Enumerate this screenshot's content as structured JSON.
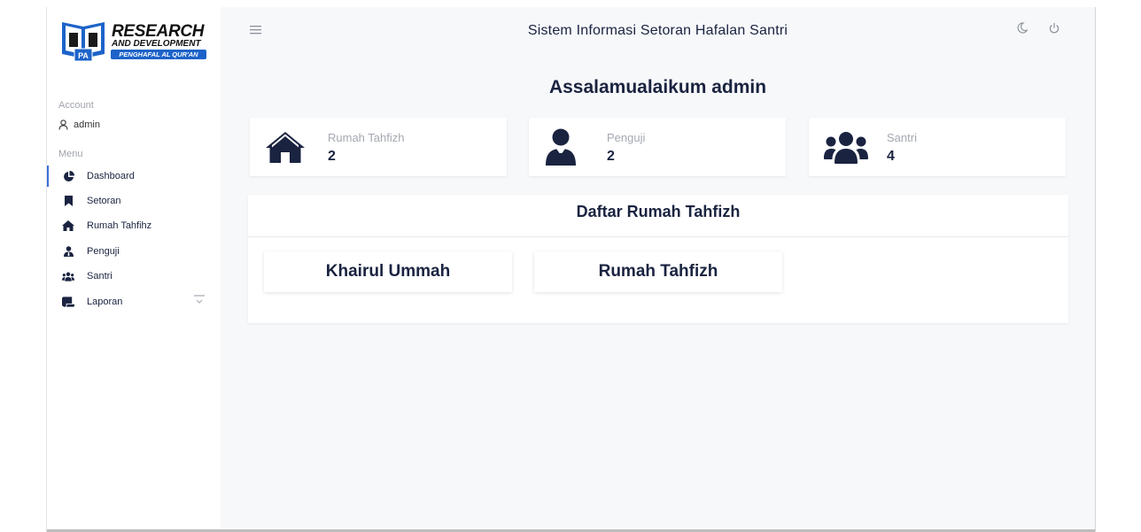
{
  "brand": {
    "line1": "RESEARCH",
    "line2": "AND DEVELOPMENT",
    "line3": "PENGHAFAL AL QUR'AN",
    "mark_text": "PA",
    "color": "#1d63c9"
  },
  "sidebar": {
    "account_label": "Account",
    "account_user": "admin",
    "menu_label": "Menu",
    "items": [
      {
        "label": "Dashboard",
        "icon": "pie-chart-icon",
        "active": true
      },
      {
        "label": "Setoran",
        "icon": "bookmark-icon"
      },
      {
        "label": "Rumah Tahfihz",
        "icon": "home-icon"
      },
      {
        "label": "Penguji",
        "icon": "user-tie-icon"
      },
      {
        "label": "Santri",
        "icon": "users-icon"
      },
      {
        "label": "Laporan",
        "icon": "scroll-icon",
        "has_dropdown": true
      }
    ]
  },
  "header": {
    "title": "Sistem Informasi Setoran Hafalan Santri",
    "menu_icon": "hamburger-icon",
    "theme_icon": "moon-icon",
    "logout_icon": "power-icon"
  },
  "main": {
    "greeting": "Assalamualaikum admin",
    "stats": [
      {
        "label": "Rumah Tahfizh",
        "value": "2",
        "icon": "home-icon"
      },
      {
        "label": "Penguji",
        "value": "2",
        "icon": "user-tie-icon"
      },
      {
        "label": "Santri",
        "value": "4",
        "icon": "users-icon"
      }
    ],
    "list_title": "Daftar Rumah Tahfizh",
    "rumah": [
      "Khairul Ummah",
      "Rumah Tahfizh"
    ]
  },
  "colors": {
    "navy": "#1a2340",
    "accent": "#3a6fd8",
    "muted": "#a3a8b0"
  }
}
